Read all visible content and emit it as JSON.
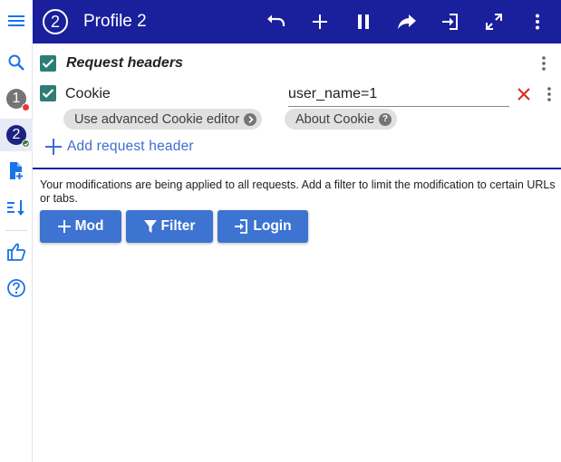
{
  "app": {
    "profile_number": "2",
    "profile_title": "Profile 2"
  },
  "rail": {
    "profiles": [
      {
        "number": "1",
        "status": "paused"
      },
      {
        "number": "2",
        "status": "active"
      }
    ]
  },
  "section": {
    "title": "Request headers",
    "checked": true
  },
  "headers": [
    {
      "name": "Cookie",
      "value": "user_name=1",
      "enabled": true
    }
  ],
  "chips": {
    "advanced_cookie": "Use advanced Cookie editor",
    "about_cookie": "About Cookie"
  },
  "add_header_label": "Add request header",
  "info_text": "Your modifications are being applied to all requests. Add a filter to limit the modification to certain URLs or tabs.",
  "buttons": {
    "mod": "Mod",
    "filter": "Filter",
    "login": "Login"
  },
  "colors": {
    "topbar": "#1a1f9c",
    "accent_button": "#3d73d1",
    "checkbox": "#2e7d74",
    "remove": "#d93025",
    "link": "#3f6cd1"
  },
  "icons": {
    "rail": [
      "menu-icon",
      "search-icon",
      "add-file-icon",
      "sort-icon",
      "thumbs-up-icon",
      "help-icon"
    ],
    "toolbar": [
      "undo-icon",
      "plus-icon",
      "pause-icon",
      "share-icon",
      "login-icon",
      "fullscreen-icon",
      "more-vert-icon"
    ]
  }
}
